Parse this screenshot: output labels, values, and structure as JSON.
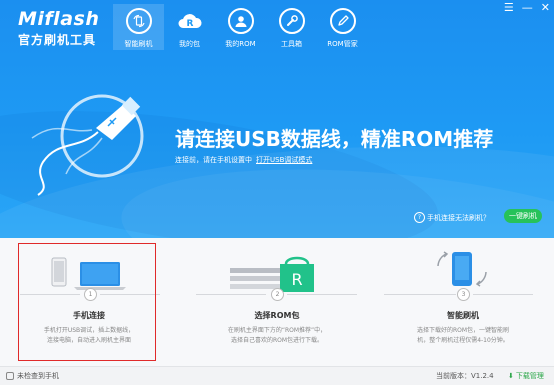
{
  "app": {
    "name_en": "Miflash",
    "name_cn": "官方刷机工具"
  },
  "window_controls": {
    "settings": "☰",
    "minimize": "—",
    "close": "✕"
  },
  "nav": [
    {
      "label": "智能刷机",
      "icon": "refresh-phone-icon",
      "active": true
    },
    {
      "label": "我的包",
      "icon": "rom-package-icon",
      "active": false
    },
    {
      "label": "我的ROM",
      "icon": "user-icon",
      "active": false
    },
    {
      "label": "工具箱",
      "icon": "wrench-icon",
      "active": false
    },
    {
      "label": "ROM管家",
      "icon": "pencil-icon",
      "active": false
    }
  ],
  "hero": {
    "title": "请连接USB数据线，精准ROM推荐",
    "subtitle": "连接前，请在手机设置中",
    "subtitle_link": "打开USB调试模式"
  },
  "help": {
    "text": "手机连接无法刷机？"
  },
  "flash_button": {
    "label": "一键刷机"
  },
  "steps": [
    {
      "num": "1",
      "title": "手机连接",
      "desc_line1": "手机打开USB调试，插上数据线，",
      "desc_line2": "连接电脑，自动进入刷机主界面"
    },
    {
      "num": "2",
      "title": "选择ROM包",
      "desc_line1": "在刷机主界面下方的“ROM推荐”中，",
      "desc_line2": "选择自己喜欢的ROM包进行下载。"
    },
    {
      "num": "3",
      "title": "智能刷机",
      "desc_line1": "选择下载好的ROM包，一键智能刷",
      "desc_line2": "机，整个刷机过程仅需4-10分钟。"
    }
  ],
  "statusbar": {
    "left": "未检查到手机",
    "version": "当前版本：V1.2.4",
    "download": "下载管理"
  },
  "colors": {
    "header_blue": "#1e9af4",
    "button_green": "#27c25a",
    "highlight_red": "#e02a2a"
  }
}
